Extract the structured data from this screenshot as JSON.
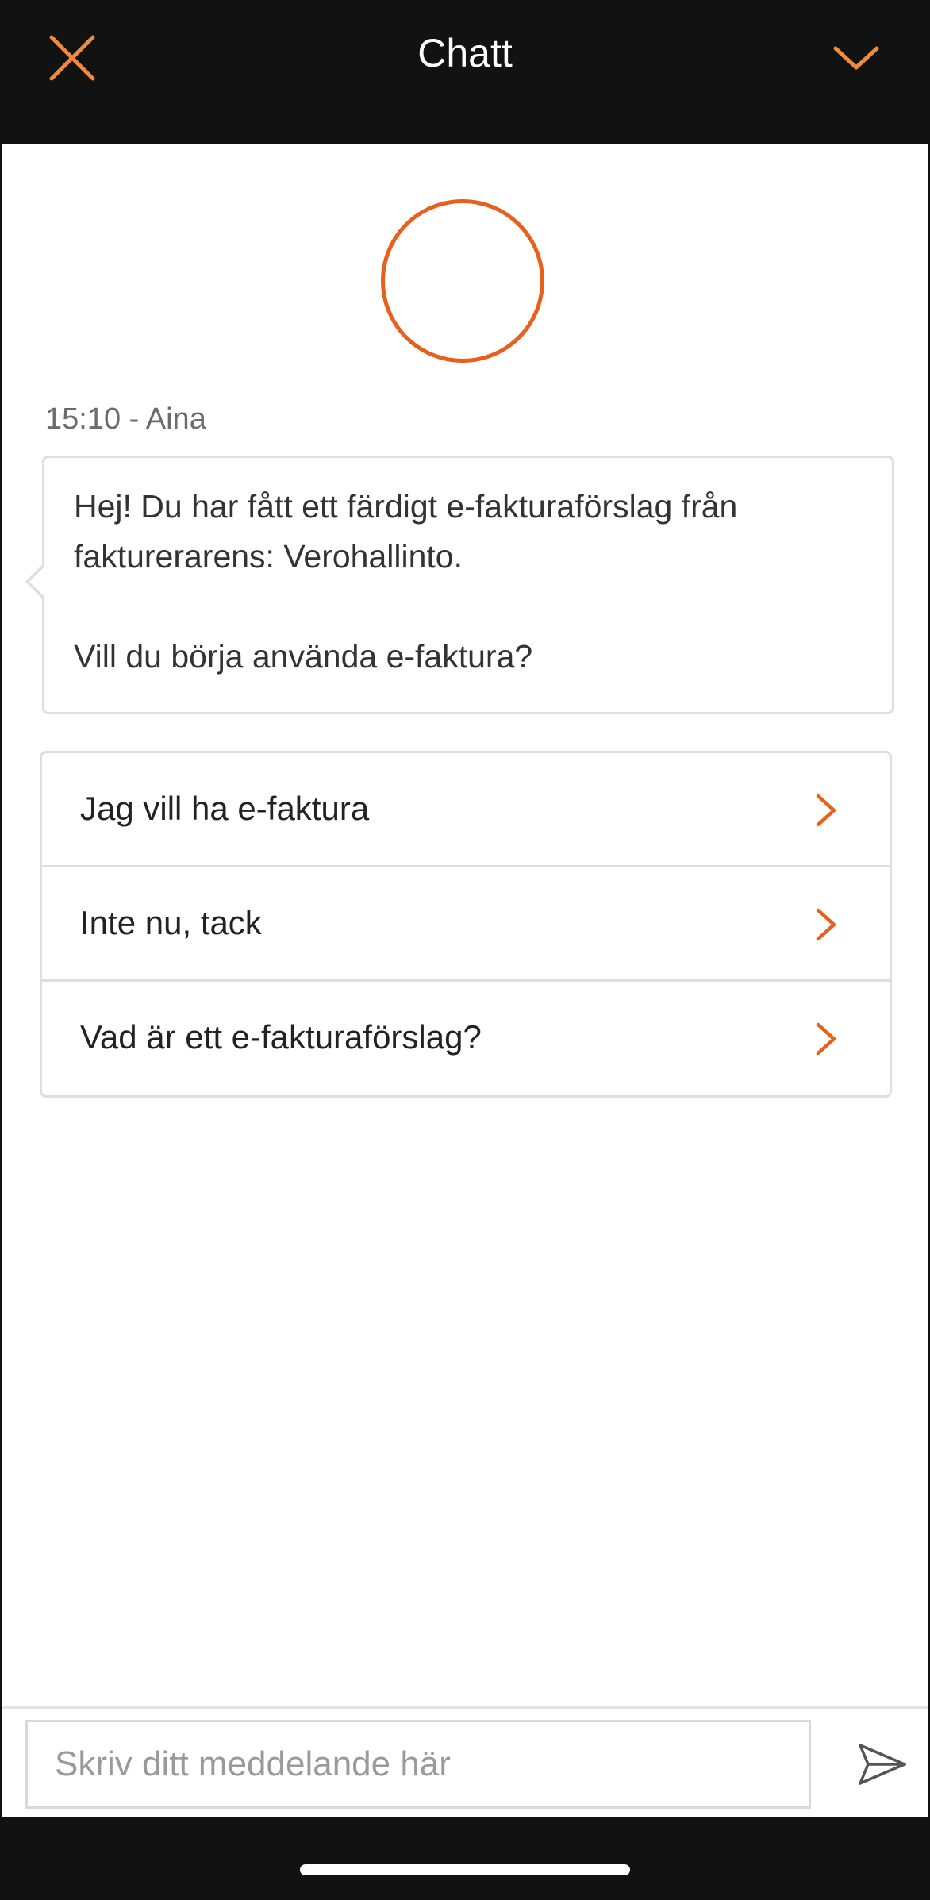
{
  "header": {
    "title": "Chatt",
    "close_icon": "close-icon",
    "collapse_icon": "chevron-down-icon"
  },
  "colors": {
    "accent": "#e8601c",
    "header_bg": "#121212",
    "content_bg": "#ffffff",
    "border": "#dedede"
  },
  "chat": {
    "avatar_icon": "avatar-circle",
    "message_meta": "15:10 - Aina",
    "message_text": "Hej! Du har fått ett färdigt e-fakturaförslag från fakturerarens: Verohallinto.\n\nVill du börja använda e-faktura?",
    "options": [
      {
        "label": "Jag vill ha e-faktura",
        "icon": "chevron-right-icon"
      },
      {
        "label": "Inte nu, tack",
        "icon": "chevron-right-icon"
      },
      {
        "label": "Vad är ett e-fakturaförslag?",
        "icon": "chevron-right-icon"
      }
    ]
  },
  "composer": {
    "placeholder": "Skriv ditt meddelande här",
    "value": "",
    "send_icon": "send-icon"
  }
}
